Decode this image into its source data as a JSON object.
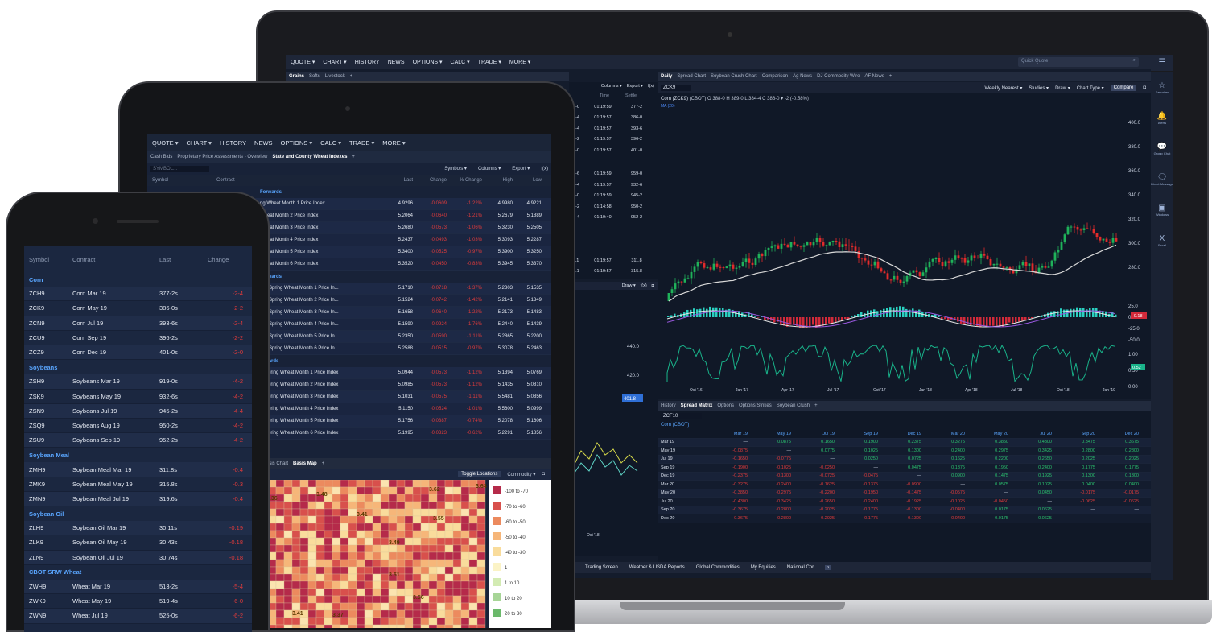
{
  "laptop": {
    "menu": [
      "QUOTE ▾",
      "CHART ▾",
      "HISTORY",
      "NEWS",
      "OPTIONS ▾",
      "CALC ▾",
      "TRADE ▾",
      "MORE ▾"
    ],
    "quick_quote_placeholder": "Quick Quote",
    "left_tabs": [
      "Grains",
      "Softs",
      "Livestock"
    ],
    "chart_tabs": [
      "Daily",
      "Spread Chart",
      "Soybean Crush Chart",
      "Comparison",
      "Ag News",
      "DJ Commodity Wire",
      "AF News"
    ],
    "symbol": "ZCK9",
    "chart_toolbar": [
      "Weekly Nearest ▾",
      "Studies ▾",
      "Draw ▾",
      "Chart Type ▾",
      "Compare"
    ],
    "chart_title": "Corn (ZCK9)",
    "chart_quote": "(CBOT) O 388-0 H 389-0 L 384-4 C 386-0 ▾ -2 (-0.58%)",
    "ma_label": "MA (20)",
    "price_ticks": [
      "400.0",
      "380.0",
      "360.0",
      "340.0",
      "320.0",
      "300.0",
      "280.0"
    ],
    "osc_ticks": [
      "25.0",
      "0.0",
      "-25.0",
      "-50.0"
    ],
    "osc_badge": "-0.18",
    "ind_ticks": [
      "1.00",
      "0.50",
      "0.00"
    ],
    "ind_badge": "0.52",
    "x_ticks": [
      "Oct '16",
      "Jan '17",
      "Apr '17",
      "Jul '17",
      "Oct '17",
      "Jan '18",
      "Apr '18",
      "Jul '18",
      "Oct '18",
      "Jan '19"
    ],
    "sidebar": [
      {
        "icon": "☆",
        "label": "Favorites"
      },
      {
        "icon": "🔔",
        "label": "Alerts"
      },
      {
        "icon": "💬",
        "label": "Group Chat"
      },
      {
        "icon": "🗨",
        "label": "Direct Message"
      },
      {
        "icon": "▣",
        "label": "Windows"
      },
      {
        "icon": "X",
        "label": "Excel"
      }
    ],
    "left_cols": [
      "Columns ▾",
      "Export ▾",
      "f(x)"
    ],
    "left_head": [
      "Time",
      "Settle"
    ],
    "left_rows": [
      [
        "76-0",
        "01:19:59",
        "377-2"
      ],
      [
        "84-4",
        "01:19:57",
        "386-0"
      ],
      [
        "93-4",
        "01:19:57",
        "393-6"
      ],
      [
        "95-2",
        "01:19:57",
        "396-2"
      ],
      [
        "03-0",
        "01:19:57",
        "401-0"
      ],
      [
        "18-6",
        "01:19:59",
        "959-0"
      ],
      [
        "30-4",
        "01:19:57",
        "932-6"
      ],
      [
        "43-0",
        "01:19:59",
        "945-2"
      ],
      [
        "48-2",
        "01:14:58",
        "950-2"
      ],
      [
        "50-4",
        "01:19:40",
        "952-2"
      ],
      [
        "11.1",
        "01:19:57",
        "311.8"
      ],
      [
        "15.1",
        "01:19:57",
        "315.8"
      ]
    ],
    "left_chart_ticks": [
      "440.0",
      "420.0",
      "401.8"
    ],
    "left_chart_toolbar": [
      "Draw ▾",
      "f(x)"
    ],
    "left_chart_x": "Oct '18",
    "right_small_ticks": [
      "380.0",
      "360.0",
      "340.0",
      "320.0",
      "300.0"
    ],
    "bottom_tabs": [
      "History",
      "Spread Matrix",
      "Options",
      "Options Strikes",
      "Soybean Crush"
    ],
    "matrix_symbol": "ZCF10",
    "matrix_group": "Corn (CBOT)",
    "matrix_cols": [
      "Mar 19",
      "May 19",
      "Jul 19",
      "Sep 19",
      "Dec 19",
      "Mar 20",
      "May 20",
      "Jul 20",
      "Sep 20",
      "Dec 20"
    ],
    "matrix_rows": [
      {
        "h": "Mar 19",
        "v": [
          "—",
          "0.0875",
          "0.1650",
          "0.1900",
          "0.2375",
          "0.3275",
          "0.3850",
          "0.4300",
          "0.3475",
          "0.3675"
        ]
      },
      {
        "h": "May 19",
        "v": [
          "-0.0875",
          "—",
          "0.0775",
          "0.1025",
          "0.1300",
          "0.2400",
          "0.2975",
          "0.3425",
          "0.2800",
          "0.2800"
        ]
      },
      {
        "h": "Jul 19",
        "v": [
          "-0.1650",
          "-0.0775",
          "—",
          "0.0250",
          "0.0725",
          "0.1625",
          "0.2200",
          "0.2650",
          "0.2025",
          "0.2025"
        ]
      },
      {
        "h": "Sep 19",
        "v": [
          "-0.1900",
          "-0.1025",
          "-0.0250",
          "—",
          "0.0475",
          "0.1375",
          "0.1950",
          "0.2400",
          "0.1775",
          "0.1775"
        ]
      },
      {
        "h": "Dec 19",
        "v": [
          "-0.2375",
          "-0.1300",
          "-0.0725",
          "-0.0475",
          "—",
          "0.0900",
          "0.1475",
          "0.1925",
          "0.1300",
          "0.1300"
        ]
      },
      {
        "h": "Mar 20",
        "v": [
          "-0.3275",
          "-0.2400",
          "-0.1625",
          "-0.1375",
          "-0.0900",
          "—",
          "0.0575",
          "0.1025",
          "0.0400",
          "0.0400"
        ]
      },
      {
        "h": "May 20",
        "v": [
          "-0.3850",
          "-0.2975",
          "-0.2200",
          "-0.1950",
          "-0.1475",
          "-0.0575",
          "—",
          "0.0450",
          "-0.0175",
          "-0.0175"
        ]
      },
      {
        "h": "Jul 20",
        "v": [
          "-0.4300",
          "-0.3425",
          "-0.2650",
          "-0.2400",
          "-0.1925",
          "-0.1025",
          "-0.0450",
          "—",
          "-0.0625",
          "-0.0625"
        ]
      },
      {
        "h": "Sep 20",
        "v": [
          "-0.3675",
          "-0.2800",
          "-0.2025",
          "-0.1775",
          "-0.1300",
          "-0.0400",
          "0.0175",
          "0.0625",
          "—",
          "—"
        ]
      },
      {
        "h": "Dec 20",
        "v": [
          "-0.3675",
          "-0.2800",
          "-0.2025",
          "-0.1775",
          "-0.1300",
          "-0.0400",
          "0.0175",
          "0.0625",
          "—",
          "—"
        ]
      }
    ],
    "footer_tabs": [
      "Trading Screen",
      "Weather & USDA Reports",
      "Global Commodities",
      "My Equities",
      "National Cor"
    ]
  },
  "tablet": {
    "menu": [
      "QUOTE ▾",
      "CHART ▾",
      "HISTORY",
      "NEWS",
      "OPTIONS ▾",
      "CALC ▾",
      "TRADE ▾",
      "MORE ▾"
    ],
    "tabs": [
      "Cash Bids",
      "Proprietary Price Assessments - Overview",
      "State and County Wheat Indexes"
    ],
    "symbol_placeholder": "SYMBOL...",
    "toolbar": [
      "Symbols ▾",
      "Columns ▾",
      "Export ▾",
      "f(x)"
    ],
    "headers": [
      "Symbol",
      "Contract",
      "Last",
      "Change",
      "% Change",
      "High",
      "Low"
    ],
    "groups": [
      {
        "title": "Forwards",
        "rows": [
          [
            "ng Wheat Month 1 Price Index",
            "4.9296",
            "-0.0609",
            "-1.22%",
            "4.9980",
            "4.9221"
          ],
          [
            "Wheat Month 2 Price Index",
            "5.2064",
            "-0.0640",
            "-1.21%",
            "5.2679",
            "5.1889"
          ],
          [
            "Wheat Month 3 Price Index",
            "5.2680",
            "-0.0573",
            "-1.06%",
            "5.3230",
            "5.2505"
          ],
          [
            "Wheat Month 4 Price Index",
            "5.2437",
            "-0.0493",
            "-1.03%",
            "5.3093",
            "5.2287"
          ],
          [
            "Wheat Month 5 Price Index",
            "5.3400",
            "-0.0525",
            "-0.97%",
            "5.3900",
            "5.3250"
          ],
          [
            "Wheat Month 6 Price Index",
            "5.3520",
            "-0.0450",
            "-0.83%",
            "5.3945",
            "5.3370"
          ]
        ]
      },
      {
        "title": "Forwards",
        "rows": [
          [
            "MN Spring Wheat Month 1 Price In...",
            "5.1710",
            "-0.0718",
            "-1.37%",
            "5.2303",
            "5.1535"
          ],
          [
            "MN Spring Wheat Month 2 Price In...",
            "5.1524",
            "-0.0742",
            "-1.42%",
            "5.2141",
            "5.1349"
          ],
          [
            "MN Spring Wheat Month 3 Price In...",
            "5.1658",
            "-0.0640",
            "-1.22%",
            "5.2173",
            "5.1483"
          ],
          [
            "MN Spring Wheat Month 4 Price In...",
            "5.1590",
            "-0.0924",
            "-1.76%",
            "5.2440",
            "5.1439"
          ],
          [
            "MN Spring Wheat Month 5 Price In...",
            "5.2350",
            "-0.0590",
            "-1.11%",
            "5.2865",
            "5.2200"
          ],
          [
            "MN Spring Wheat Month 6 Price In...",
            "5.2588",
            "-0.0515",
            "-0.97%",
            "5.3078",
            "5.2463"
          ]
        ]
      },
      {
        "title": "orwards",
        "rows": [
          [
            "N Spring Wheat Month 1 Price Index",
            "5.0944",
            "-0.0573",
            "-1.12%",
            "5.1394",
            "5.0769"
          ],
          [
            "N Spring Wheat Month 2 Price Index",
            "5.0985",
            "-0.0573",
            "-1.12%",
            "5.1435",
            "5.0810"
          ],
          [
            "N Spring Wheat Month 3 Price Index",
            "5.1031",
            "-0.0575",
            "-1.11%",
            "5.5481",
            "5.0856"
          ],
          [
            "N Spring Wheat Month 4 Price Index",
            "5.1150",
            "-0.0524",
            "-1.01%",
            "5.5600",
            "5.0999"
          ],
          [
            "N Spring Wheat Month 5 Price Index",
            "5.1756",
            "-0.0387",
            "-0.74%",
            "5.2078",
            "5.1606"
          ],
          [
            "N Spring Wheat Month 6 Price Index",
            "5.1995",
            "-0.0323",
            "-0.62%",
            "5.2291",
            "5.1856"
          ]
        ]
      }
    ],
    "map_tabs": [
      "Basis Chart",
      "Basis Map"
    ],
    "map_toolbar": [
      "Toggle Locations",
      "Commodity ▾"
    ],
    "map_labels": [
      "3.64",
      "3.36",
      "3.48",
      "3.41",
      "3.49",
      "3.55",
      "3.51",
      "3.56",
      "3.41",
      "3.37",
      "3.62"
    ],
    "legend": [
      {
        "c": "#b52a4a",
        "t": "-100 to -70"
      },
      {
        "c": "#d8504c",
        "t": "-70 to -60"
      },
      {
        "c": "#ec8a5e",
        "t": "-60 to -50"
      },
      {
        "c": "#f6b679",
        "t": "-50 to -40"
      },
      {
        "c": "#f9dc9c",
        "t": "-40 to -30"
      },
      {
        "c": "#fbf3c6",
        "t": "1"
      },
      {
        "c": "#d3ebb3",
        "t": "1 to 10"
      },
      {
        "c": "#a7d597",
        "t": "10 to 20"
      },
      {
        "c": "#6bb96b",
        "t": "20 to 30"
      }
    ]
  },
  "phone": {
    "headers": [
      "Symbol",
      "Contract",
      "Last",
      "Change"
    ],
    "groups": [
      {
        "title": "Corn",
        "rows": [
          [
            "ZCH9",
            "Corn Mar 19",
            "377-2s",
            "-2-4"
          ],
          [
            "ZCK9",
            "Corn May 19",
            "386-0s",
            "-2-2"
          ],
          [
            "ZCN9",
            "Corn Jul 19",
            "393-6s",
            "-2-4"
          ],
          [
            "ZCU9",
            "Corn Sep 19",
            "396-2s",
            "-2-2"
          ],
          [
            "ZCZ9",
            "Corn Dec 19",
            "401-0s",
            "-2-0"
          ]
        ]
      },
      {
        "title": "Soybeans",
        "rows": [
          [
            "ZSH9",
            "Soybeans Mar 19",
            "919-0s",
            "-4-2"
          ],
          [
            "ZSK9",
            "Soybeans May 19",
            "932-6s",
            "-4-2"
          ],
          [
            "ZSN9",
            "Soybeans Jul 19",
            "945-2s",
            "-4-4"
          ],
          [
            "ZSQ9",
            "Soybeans Aug 19",
            "950-2s",
            "-4-2"
          ],
          [
            "ZSU9",
            "Soybeans Sep 19",
            "952-2s",
            "-4-2"
          ]
        ]
      },
      {
        "title": "Soybean Meal",
        "rows": [
          [
            "ZMH9",
            "Soybean Meal Mar 19",
            "311.8s",
            "-0.4"
          ],
          [
            "ZMK9",
            "Soybean Meal May 19",
            "315.8s",
            "-0.3"
          ],
          [
            "ZMN9",
            "Soybean Meal Jul 19",
            "319.6s",
            "-0.4"
          ]
        ]
      },
      {
        "title": "Soybean Oil",
        "rows": [
          [
            "ZLH9",
            "Soybean Oil Mar 19",
            "30.11s",
            "-0.19"
          ],
          [
            "ZLK9",
            "Soybean Oil May 19",
            "30.43s",
            "-0.18"
          ],
          [
            "ZLN9",
            "Soybean Oil Jul 19",
            "30.74s",
            "-0.18"
          ]
        ]
      },
      {
        "title": "CBOT SRW Wheat",
        "rows": [
          [
            "ZWH9",
            "Wheat Mar 19",
            "513-2s",
            "-5-4"
          ],
          [
            "ZWK9",
            "Wheat May 19",
            "519-4s",
            "-6-0"
          ],
          [
            "ZWN9",
            "Wheat Jul 19",
            "525-0s",
            "-6-2"
          ]
        ]
      }
    ]
  }
}
